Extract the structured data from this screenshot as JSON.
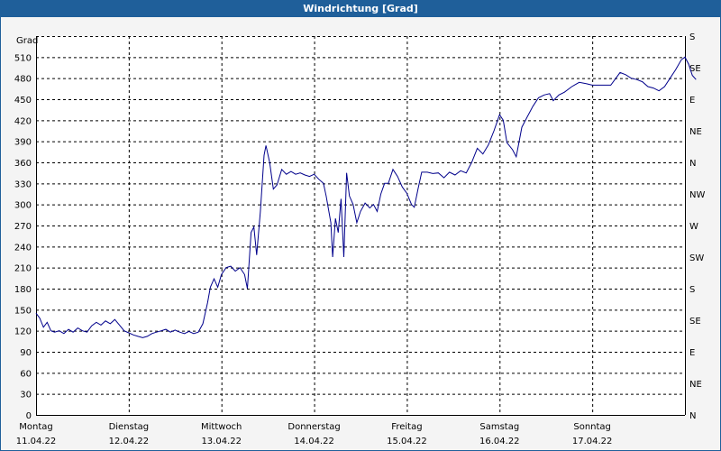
{
  "window": {
    "title": "Windrichtung [Grad]"
  },
  "colors": {
    "titlebar": "#1f5f9a",
    "line": "#00008b",
    "plot_bg": "#ffffff",
    "grid": "#000000"
  },
  "chart_data": {
    "type": "line",
    "title": "Windrichtung [Grad]",
    "ylabel": "Grad",
    "xlabel": "",
    "ylim": [
      0,
      540
    ],
    "xlim": [
      0,
      7
    ],
    "grid": true,
    "legend": "none",
    "y_ticks": [
      0,
      30,
      60,
      90,
      120,
      150,
      180,
      210,
      240,
      270,
      300,
      330,
      360,
      390,
      420,
      450,
      480,
      510
    ],
    "right_axis_labels": [
      "N",
      "NE",
      "E",
      "SE",
      "S",
      "SW",
      "W",
      "NW",
      "N",
      "NE",
      "E",
      "SE",
      "S"
    ],
    "x_ticks": [
      {
        "day": "Montag",
        "date": "11.04.22"
      },
      {
        "day": "Dienstag",
        "date": "12.04.22"
      },
      {
        "day": "Mittwoch",
        "date": "13.04.22"
      },
      {
        "day": "Donnerstag",
        "date": "14.04.22"
      },
      {
        "day": "Freitag",
        "date": "15.04.22"
      },
      {
        "day": "Samstag",
        "date": "16.04.22"
      },
      {
        "day": "Sonntag",
        "date": "17.04.22"
      }
    ],
    "series": [
      {
        "values": [
          [
            0.0,
            145
          ],
          [
            0.04,
            138
          ],
          [
            0.08,
            125
          ],
          [
            0.12,
            132
          ],
          [
            0.16,
            120
          ],
          [
            0.2,
            118
          ],
          [
            0.25,
            120
          ],
          [
            0.3,
            116
          ],
          [
            0.35,
            122
          ],
          [
            0.4,
            118
          ],
          [
            0.45,
            124
          ],
          [
            0.5,
            120
          ],
          [
            0.55,
            118
          ],
          [
            0.6,
            127
          ],
          [
            0.65,
            132
          ],
          [
            0.7,
            128
          ],
          [
            0.75,
            134
          ],
          [
            0.8,
            130
          ],
          [
            0.85,
            136
          ],
          [
            0.9,
            128
          ],
          [
            0.95,
            120
          ],
          [
            1.0,
            117
          ],
          [
            1.05,
            114
          ],
          [
            1.1,
            112
          ],
          [
            1.15,
            110
          ],
          [
            1.2,
            112
          ],
          [
            1.25,
            116
          ],
          [
            1.3,
            118
          ],
          [
            1.35,
            120
          ],
          [
            1.4,
            122
          ],
          [
            1.45,
            118
          ],
          [
            1.5,
            121
          ],
          [
            1.55,
            118
          ],
          [
            1.6,
            116
          ],
          [
            1.65,
            119
          ],
          [
            1.7,
            116
          ],
          [
            1.75,
            118
          ],
          [
            1.8,
            130
          ],
          [
            1.85,
            160
          ],
          [
            1.88,
            182
          ],
          [
            1.92,
            194
          ],
          [
            1.96,
            182
          ],
          [
            2.0,
            200
          ],
          [
            2.05,
            210
          ],
          [
            2.1,
            212
          ],
          [
            2.15,
            205
          ],
          [
            2.2,
            210
          ],
          [
            2.25,
            200
          ],
          [
            2.28,
            180
          ],
          [
            2.32,
            260
          ],
          [
            2.35,
            268
          ],
          [
            2.38,
            228
          ],
          [
            2.42,
            290
          ],
          [
            2.46,
            370
          ],
          [
            2.48,
            384
          ],
          [
            2.52,
            360
          ],
          [
            2.56,
            322
          ],
          [
            2.6,
            328
          ],
          [
            2.65,
            350
          ],
          [
            2.7,
            343
          ],
          [
            2.75,
            347
          ],
          [
            2.8,
            343
          ],
          [
            2.85,
            345
          ],
          [
            2.9,
            342
          ],
          [
            2.95,
            340
          ],
          [
            3.0,
            343
          ],
          [
            3.05,
            336
          ],
          [
            3.1,
            330
          ],
          [
            3.13,
            312
          ],
          [
            3.18,
            274
          ],
          [
            3.2,
            225
          ],
          [
            3.23,
            280
          ],
          [
            3.26,
            260
          ],
          [
            3.29,
            308
          ],
          [
            3.32,
            225
          ],
          [
            3.35,
            345
          ],
          [
            3.38,
            312
          ],
          [
            3.42,
            300
          ],
          [
            3.46,
            274
          ],
          [
            3.5,
            290
          ],
          [
            3.55,
            302
          ],
          [
            3.6,
            295
          ],
          [
            3.64,
            300
          ],
          [
            3.68,
            290
          ],
          [
            3.72,
            315
          ],
          [
            3.76,
            330
          ],
          [
            3.8,
            330
          ],
          [
            3.85,
            350
          ],
          [
            3.9,
            340
          ],
          [
            3.95,
            325
          ],
          [
            4.0,
            316
          ],
          [
            4.05,
            300
          ],
          [
            4.08,
            296
          ],
          [
            4.12,
            322
          ],
          [
            4.16,
            346
          ],
          [
            4.22,
            346
          ],
          [
            4.28,
            344
          ],
          [
            4.34,
            345
          ],
          [
            4.4,
            338
          ],
          [
            4.46,
            346
          ],
          [
            4.52,
            342
          ],
          [
            4.58,
            348
          ],
          [
            4.64,
            345
          ],
          [
            4.7,
            360
          ],
          [
            4.76,
            380
          ],
          [
            4.82,
            372
          ],
          [
            4.88,
            385
          ],
          [
            4.94,
            405
          ],
          [
            5.0,
            428
          ],
          [
            5.04,
            420
          ],
          [
            5.08,
            388
          ],
          [
            5.14,
            378
          ],
          [
            5.18,
            368
          ],
          [
            5.24,
            410
          ],
          [
            5.3,
            425
          ],
          [
            5.36,
            440
          ],
          [
            5.42,
            452
          ],
          [
            5.48,
            456
          ],
          [
            5.54,
            458
          ],
          [
            5.58,
            448
          ],
          [
            5.64,
            456
          ],
          [
            5.7,
            460
          ],
          [
            5.78,
            468
          ],
          [
            5.86,
            474
          ],
          [
            5.94,
            472
          ],
          [
            6.0,
            470
          ],
          [
            6.1,
            470
          ],
          [
            6.2,
            470
          ],
          [
            6.3,
            488
          ],
          [
            6.36,
            485
          ],
          [
            6.42,
            480
          ],
          [
            6.48,
            478
          ],
          [
            6.54,
            475
          ],
          [
            6.6,
            468
          ],
          [
            6.66,
            466
          ],
          [
            6.72,
            462
          ],
          [
            6.78,
            468
          ],
          [
            6.84,
            480
          ],
          [
            6.9,
            492
          ],
          [
            6.96,
            506
          ],
          [
            7.0,
            510
          ],
          [
            7.04,
            500
          ],
          [
            7.08,
            484
          ],
          [
            7.12,
            478
          ]
        ]
      }
    ]
  }
}
